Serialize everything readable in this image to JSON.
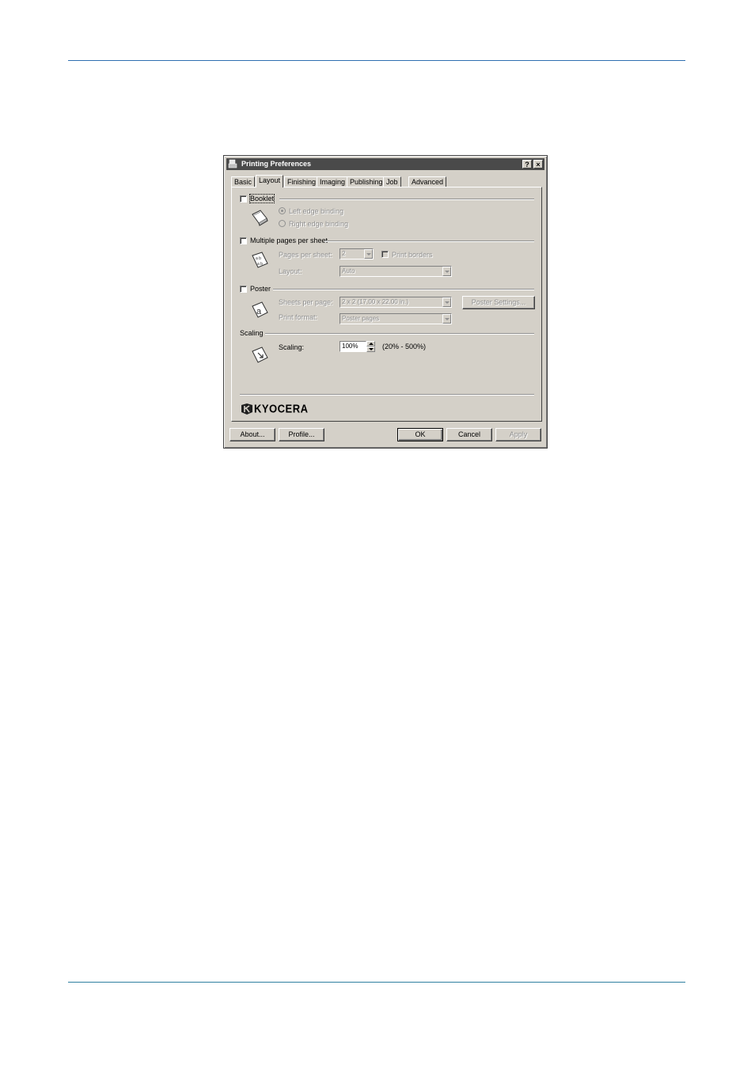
{
  "dialog": {
    "title": "Printing Preferences",
    "help_label": "?",
    "close_label": "×"
  },
  "tabs": [
    "Basic",
    "Layout",
    "Finishing",
    "Imaging",
    "Publishing",
    "Job",
    "Advanced"
  ],
  "active_tab": "Layout",
  "booklet": {
    "label": "Booklet",
    "checked": false,
    "left_binding": "Left edge binding",
    "right_binding": "Right edge binding"
  },
  "multiple_pages": {
    "label": "Multiple pages per sheet",
    "checked": false,
    "pages_per_sheet_label": "Pages per sheet:",
    "pages_per_sheet_value": "2",
    "print_borders_label": "Print borders",
    "layout_label": "Layout:",
    "layout_value": "Auto"
  },
  "poster": {
    "label": "Poster",
    "checked": false,
    "sheets_per_page_label": "Sheets per page:",
    "sheets_per_page_value": "2 x 2 (17.00 x 22.00 in.)",
    "poster_settings_label": "Poster Settings...",
    "print_format_label": "Print format:",
    "print_format_value": "Poster pages"
  },
  "scaling": {
    "section_label": "Scaling",
    "label": "Scaling:",
    "value": "100%",
    "range": "(20% - 500%)"
  },
  "brand": {
    "logo_text": "KYOCERA"
  },
  "buttons": {
    "about": "About...",
    "profile": "Profile...",
    "ok": "OK",
    "cancel": "Cancel",
    "apply": "Apply"
  }
}
